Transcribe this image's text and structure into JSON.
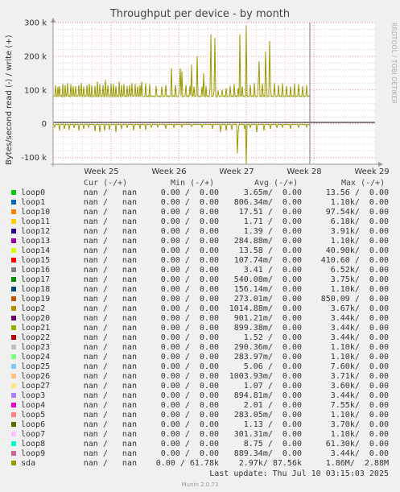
{
  "title": "Throughput per device - by month",
  "side_label": "RRDTOOL / TOBI OETIKER",
  "chart_data": {
    "type": "line",
    "title": "Throughput per device - by month",
    "ylabel": "Bytes/second read (-) / write (+)",
    "y_ticks": [
      {
        "value": 300000,
        "label": "300 k"
      },
      {
        "value": 200000,
        "label": "200 k"
      },
      {
        "value": 100000,
        "label": "100 k"
      },
      {
        "value": 0,
        "label": "0"
      },
      {
        "value": -100000,
        "label": "-100 k"
      }
    ],
    "ylim": [
      -120000,
      300000
    ],
    "x_ticks": [
      "Week 25",
      "Week 26",
      "Week 27",
      "Week 28",
      "Week 29"
    ],
    "grid": true,
    "series": [
      {
        "name": "sda",
        "color": "#999900",
        "write_spikes": [
          [
            0,
            80000
          ],
          [
            3,
            115000
          ],
          [
            6,
            110000
          ],
          [
            8,
            112000
          ],
          [
            12,
            118000
          ],
          [
            15,
            115000
          ],
          [
            18,
            120000
          ],
          [
            22,
            118000
          ],
          [
            25,
            112000
          ],
          [
            28,
            112000
          ],
          [
            32,
            115000
          ],
          [
            35,
            120000
          ],
          [
            38,
            110000
          ],
          [
            42,
            115000
          ],
          [
            45,
            118000
          ],
          [
            48,
            115000
          ],
          [
            52,
            112000
          ],
          [
            55,
            125000
          ],
          [
            58,
            118000
          ],
          [
            62,
            115000
          ],
          [
            65,
            130000
          ],
          [
            68,
            115000
          ],
          [
            72,
            120000
          ],
          [
            75,
            118000
          ],
          [
            78,
            112000
          ],
          [
            82,
            125000
          ],
          [
            85,
            115000
          ],
          [
            88,
            118000
          ],
          [
            92,
            112000
          ],
          [
            95,
            115000
          ],
          [
            98,
            120000
          ],
          [
            102,
            118000
          ],
          [
            105,
            112000
          ],
          [
            108,
            115000
          ],
          [
            110,
            125000
          ],
          [
            115,
            120000
          ],
          [
            120,
            118000
          ],
          [
            128,
            112000
          ],
          [
            135,
            110000
          ],
          [
            140,
            115000
          ],
          [
            147,
            112000
          ],
          [
            152,
            115000
          ],
          [
            157,
            112000
          ],
          [
            160,
            120000
          ],
          [
            165,
            115000
          ],
          [
            170,
            112000
          ],
          [
            175,
            110000
          ],
          [
            185,
            110000
          ],
          [
            190,
            112000
          ],
          [
            195,
            105000
          ],
          [
            200,
            100000
          ],
          [
            205,
            98000
          ],
          [
            210,
            100000
          ],
          [
            215,
            105000
          ],
          [
            220,
            112000
          ],
          [
            225,
            118000
          ],
          [
            230,
            105000
          ],
          [
            235,
            110000
          ],
          [
            240,
            110000
          ],
          [
            245,
            115000
          ],
          [
            250,
            120000
          ],
          [
            255,
            130000
          ],
          [
            260,
            120000
          ],
          [
            265,
            125000
          ],
          [
            270,
            110000
          ],
          [
            275,
            120000
          ],
          [
            280,
            115000
          ],
          [
            285,
            120000
          ],
          [
            290,
            112000
          ],
          [
            295,
            110000
          ],
          [
            300,
            120000
          ],
          [
            305,
            118000
          ],
          [
            310,
            112000
          ],
          [
            315,
            115000
          ],
          [
            320,
            118000
          ],
          [
            325,
            113000
          ],
          [
            330,
            115000
          ],
          [
            335,
            120000
          ],
          [
            340,
            115000
          ],
          [
            345,
            112000
          ],
          [
            350,
            115000
          ],
          [
            355,
            118000
          ],
          [
            360,
            112000
          ],
          [
            365,
            115000
          ],
          [
            370,
            110000
          ],
          [
            374,
            115000
          ],
          [
            378,
            135000
          ],
          [
            380,
            145000
          ]
        ],
        "read_dips": [
          [
            2,
            -10000
          ],
          [
            8,
            -20000
          ],
          [
            14,
            -15000
          ],
          [
            20,
            -18000
          ],
          [
            26,
            -12000
          ],
          [
            32,
            -20000
          ],
          [
            38,
            -15000
          ],
          [
            44,
            -10000
          ],
          [
            52,
            -22000
          ],
          [
            58,
            -25000
          ],
          [
            64,
            -20000
          ],
          [
            70,
            -18000
          ],
          [
            78,
            -25000
          ],
          [
            85,
            -15000
          ],
          [
            92,
            -12000
          ],
          [
            100,
            -20000
          ],
          [
            108,
            -15000
          ],
          [
            115,
            -18000
          ],
          [
            122,
            -12000
          ],
          [
            130,
            -10000
          ],
          [
            140,
            -15000
          ],
          [
            150,
            -12000
          ],
          [
            160,
            -10000
          ],
          [
            172,
            -8000
          ],
          [
            185,
            -10000
          ],
          [
            198,
            -15000
          ],
          [
            208,
            -25000
          ],
          [
            215,
            -20000
          ],
          [
            222,
            -18000
          ],
          [
            230,
            -22000
          ],
          [
            238,
            -15000
          ],
          [
            245,
            -12000
          ],
          [
            253,
            -25000
          ],
          [
            262,
            -20000
          ],
          [
            270,
            -15000
          ],
          [
            278,
            -12000
          ],
          [
            285,
            -10000
          ],
          [
            295,
            -15000
          ],
          [
            305,
            -12000
          ],
          [
            315,
            -10000
          ],
          [
            325,
            -15000
          ],
          [
            335,
            -12000
          ],
          [
            345,
            -10000
          ],
          [
            355,
            -15000
          ],
          [
            362,
            -12000
          ],
          [
            370,
            -10000
          ],
          [
            377,
            -25000
          ],
          [
            380,
            -50000
          ]
        ]
      }
    ]
  },
  "annotations": {
    "tall_spikes": [
      [
        196,
        265000
      ],
      [
        201,
        255000
      ],
      [
        240,
        290000
      ],
      [
        232,
        265000
      ],
      [
        160,
        155000
      ],
      [
        172,
        175000
      ],
      [
        179,
        200000
      ],
      [
        147,
        165000
      ],
      [
        158,
        165000
      ],
      [
        187,
        150000
      ],
      [
        256,
        185000
      ],
      [
        269,
        245000
      ],
      [
        264,
        215000
      ],
      [
        325,
        145000
      ],
      [
        379,
        140000
      ]
    ],
    "deep_dips": [
      [
        240,
        -120000
      ],
      [
        229,
        -88000
      ],
      [
        380,
        -60000
      ]
    ]
  },
  "table": {
    "headers": {
      "cur": "Cur (-/+)",
      "min": "Min (-/+)",
      "avg": "Avg (-/+)",
      "max": "Max (-/+)"
    },
    "rows": [
      {
        "name": "loop0",
        "color": "#00cc00",
        "cur": "nan /   nan",
        "min": "0.00 /  0.00",
        "avg": "3.65m/  0.00",
        "max": "13.56 /  0.00"
      },
      {
        "name": "loop1",
        "color": "#0066b3",
        "cur": "nan /   nan",
        "min": "0.00 /  0.00",
        "avg": "806.34m/  0.00",
        "max": "1.10k/  0.00"
      },
      {
        "name": "loop10",
        "color": "#ff8000",
        "cur": "nan /   nan",
        "min": "0.00 /  0.00",
        "avg": "17.51 /  0.00",
        "max": "97.54k/  0.00"
      },
      {
        "name": "loop11",
        "color": "#ffcc00",
        "cur": "nan /   nan",
        "min": "0.00 /  0.00",
        "avg": "1.71 /  0.00",
        "max": "6.18k/  0.00"
      },
      {
        "name": "loop12",
        "color": "#330099",
        "cur": "nan /   nan",
        "min": "0.00 /  0.00",
        "avg": "1.39 /  0.00",
        "max": "3.91k/  0.00"
      },
      {
        "name": "loop13",
        "color": "#990099",
        "cur": "nan /   nan",
        "min": "0.00 /  0.00",
        "avg": "284.88m/  0.00",
        "max": "1.10k/  0.00"
      },
      {
        "name": "loop14",
        "color": "#ccff00",
        "cur": "nan /   nan",
        "min": "0.00 /  0.00",
        "avg": "13.58 /  0.00",
        "max": "40.90k/  0.00"
      },
      {
        "name": "loop15",
        "color": "#ff0000",
        "cur": "nan /   nan",
        "min": "0.00 /  0.00",
        "avg": "107.74m/  0.00",
        "max": "410.60 /  0.00"
      },
      {
        "name": "loop16",
        "color": "#808080",
        "cur": "nan /   nan",
        "min": "0.00 /  0.00",
        "avg": "3.41 /  0.00",
        "max": "6.52k/  0.00"
      },
      {
        "name": "loop17",
        "color": "#008f00",
        "cur": "nan /   nan",
        "min": "0.00 /  0.00",
        "avg": "540.08m/  0.00",
        "max": "3.75k/  0.00"
      },
      {
        "name": "loop18",
        "color": "#00487d",
        "cur": "nan /   nan",
        "min": "0.00 /  0.00",
        "avg": "156.14m/  0.00",
        "max": "1.10k/  0.00"
      },
      {
        "name": "loop19",
        "color": "#b35a00",
        "cur": "nan /   nan",
        "min": "0.00 /  0.00",
        "avg": "273.01m/  0.00",
        "max": "850.09 /  0.00"
      },
      {
        "name": "loop2",
        "color": "#b38f00",
        "cur": "nan /   nan",
        "min": "0.00 /  0.00",
        "avg": "1014.88m/  0.00",
        "max": "3.67k/  0.00"
      },
      {
        "name": "loop20",
        "color": "#6b006b",
        "cur": "nan /   nan",
        "min": "0.00 /  0.00",
        "avg": "901.21m/  0.00",
        "max": "3.44k/  0.00"
      },
      {
        "name": "loop21",
        "color": "#8fb300",
        "cur": "nan /   nan",
        "min": "0.00 /  0.00",
        "avg": "899.38m/  0.00",
        "max": "3.44k/  0.00"
      },
      {
        "name": "loop22",
        "color": "#b30000",
        "cur": "nan /   nan",
        "min": "0.00 /  0.00",
        "avg": "1.52 /  0.00",
        "max": "3.44k/  0.00"
      },
      {
        "name": "loop23",
        "color": "#bebebe",
        "cur": "nan /   nan",
        "min": "0.00 /  0.00",
        "avg": "290.36m/  0.00",
        "max": "1.10k/  0.00"
      },
      {
        "name": "loop24",
        "color": "#80ff80",
        "cur": "nan /   nan",
        "min": "0.00 /  0.00",
        "avg": "283.97m/  0.00",
        "max": "1.10k/  0.00"
      },
      {
        "name": "loop25",
        "color": "#80c9ff",
        "cur": "nan /   nan",
        "min": "0.00 /  0.00",
        "avg": "5.06 /  0.00",
        "max": "7.60k/  0.00"
      },
      {
        "name": "loop26",
        "color": "#ffc080",
        "cur": "nan /   nan",
        "min": "0.00 /  0.00",
        "avg": "1003.93m/  0.00",
        "max": "3.71k/  0.00"
      },
      {
        "name": "loop27",
        "color": "#ffe680",
        "cur": "nan /   nan",
        "min": "0.00 /  0.00",
        "avg": "1.07 /  0.00",
        "max": "3.60k/  0.00"
      },
      {
        "name": "loop3",
        "color": "#aa80ff",
        "cur": "nan /   nan",
        "min": "0.00 /  0.00",
        "avg": "894.81m/  0.00",
        "max": "3.44k/  0.00"
      },
      {
        "name": "loop4",
        "color": "#ee00cc",
        "cur": "nan /   nan",
        "min": "0.00 /  0.00",
        "avg": "2.01 /  0.00",
        "max": "7.55k/  0.00"
      },
      {
        "name": "loop5",
        "color": "#ff8080",
        "cur": "nan /   nan",
        "min": "0.00 /  0.00",
        "avg": "283.05m/  0.00",
        "max": "1.10k/  0.00"
      },
      {
        "name": "loop6",
        "color": "#666600",
        "cur": "nan /   nan",
        "min": "0.00 /  0.00",
        "avg": "1.13 /  0.00",
        "max": "3.70k/  0.00"
      },
      {
        "name": "loop7",
        "color": "#ffbfff",
        "cur": "nan /   nan",
        "min": "0.00 /  0.00",
        "avg": "301.31m/  0.00",
        "max": "1.10k/  0.00"
      },
      {
        "name": "loop8",
        "color": "#00ffcc",
        "cur": "nan /   nan",
        "min": "0.00 /  0.00",
        "avg": "8.75 /  0.00",
        "max": "61.30k/  0.00"
      },
      {
        "name": "loop9",
        "color": "#cc6699",
        "cur": "nan /   nan",
        "min": "0.00 /  0.00",
        "avg": "889.34m/  0.00",
        "max": "3.44k/  0.00"
      },
      {
        "name": "sda",
        "color": "#999900",
        "cur": "nan /   nan",
        "min": "0.00 / 61.78k",
        "avg": "2.97k/ 87.56k",
        "max": "1.86M/  2.88M"
      }
    ]
  },
  "last_update": "Last update: Thu Jul 10 03:15:03 2025",
  "version": "Munin 2.0.73"
}
